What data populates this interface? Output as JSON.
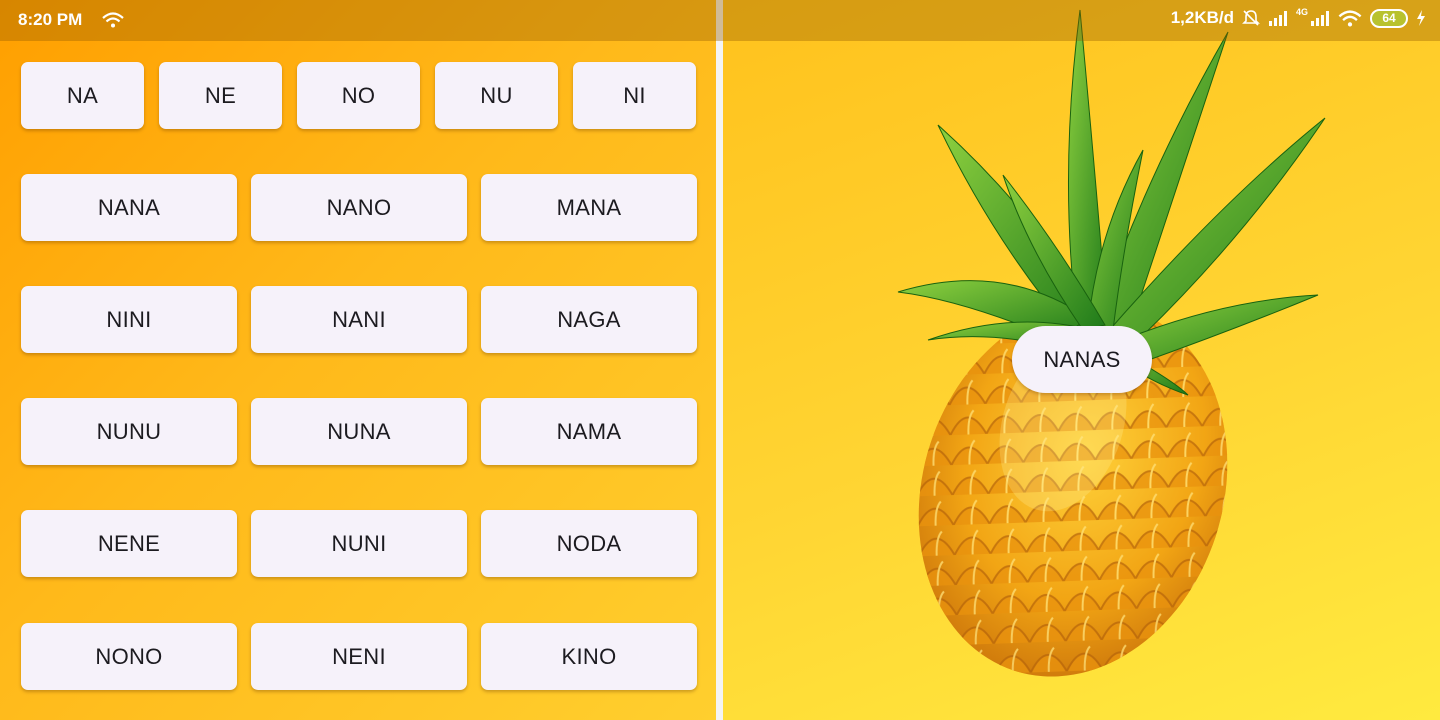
{
  "status_bar": {
    "time": "8:20 PM",
    "network_speed": "1,2KB/d",
    "network_type": "4G",
    "battery_level": "64",
    "icons": [
      "wifi-icon",
      "alarm-off-icon",
      "signal-icon",
      "signal-4g-icon",
      "wifi-icon",
      "battery-icon",
      "charging-icon"
    ]
  },
  "syllables": {
    "row1": [
      "NA",
      "NE",
      "NO",
      "NU",
      "NI"
    ],
    "row2": [
      "NANA",
      "NANO",
      "MANA"
    ],
    "row3": [
      "NINI",
      "NANI",
      "NAGA"
    ],
    "row4": [
      "NUNU",
      "NUNA",
      "NAMA"
    ],
    "row5": [
      "NENE",
      "NUNI",
      "NODA"
    ],
    "row6": [
      "NONO",
      "NENI",
      "KINO"
    ]
  },
  "preview": {
    "image": "pineapple-illustration",
    "word": "NANAS"
  },
  "colors": {
    "left_background_start": "#ff9f00",
    "left_background_end": "#ffcf2e",
    "right_background": "#ffd533",
    "button_background": "#f6f2fa",
    "button_text": "#1c1b20"
  }
}
